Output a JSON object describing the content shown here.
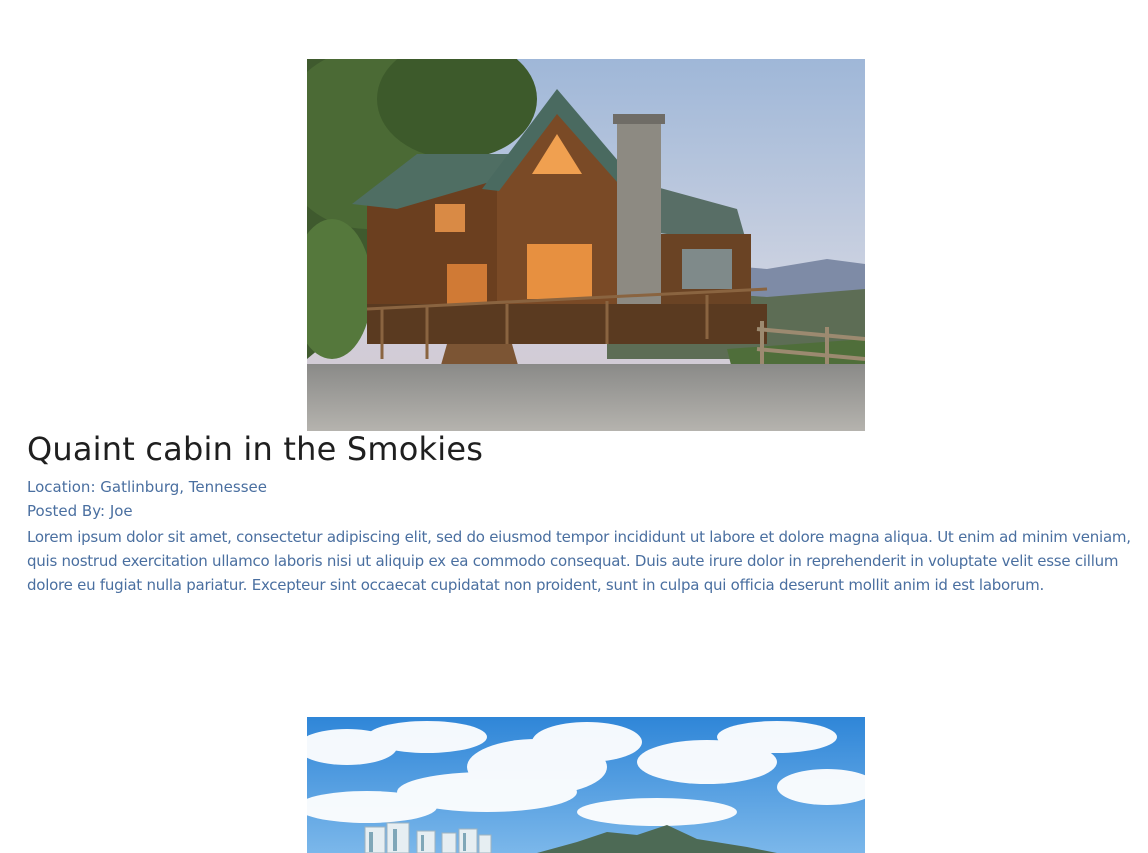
{
  "posts": [
    {
      "image_alt": "Log cabin with deck overlooking mountains",
      "title": "Quaint cabin in the Smokies",
      "location_label": "Location: ",
      "location": "Gatlinburg, Tennessee",
      "posted_by_label": "Posted By: ",
      "posted_by": "Joe",
      "description": "Lorem ipsum dolor sit amet, consectetur adipiscing elit, sed do eiusmod tempor incididunt ut labore et dolore magna aliqua. Ut enim ad minim veniam, quis nostrud exercitation ullamco laboris nisi ut aliquip ex ea commodo consequat. Duis aute irure dolor in reprehenderit in voluptate velit esse cillum dolore eu fugiat nulla pariatur. Excepteur sint occaecat cupidatat non proident, sunt in culpa qui officia deserunt mollit anim id est laborum."
    },
    {
      "image_alt": "City skyline with mountain under blue sky"
    }
  ],
  "colors": {
    "title": "#1f1f1f",
    "meta_text": "#4a6fa0",
    "background": "#ffffff"
  }
}
